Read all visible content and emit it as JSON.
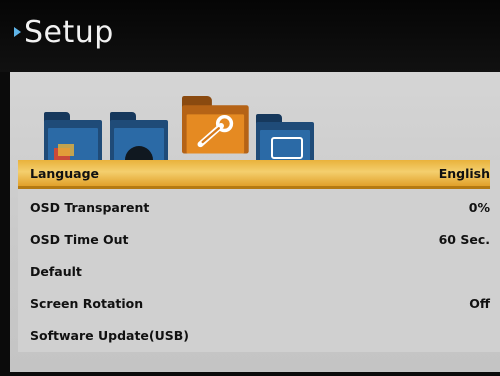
{
  "header": {
    "title": "Setup"
  },
  "tabs": [
    {
      "icon": "picture-folder-icon",
      "selected": false
    },
    {
      "icon": "sound-folder-icon",
      "selected": false
    },
    {
      "icon": "setup-wrench-folder-icon",
      "selected": true
    },
    {
      "icon": "screen-folder-icon",
      "selected": false
    }
  ],
  "menu": {
    "items": [
      {
        "label": "Language",
        "value": "English",
        "selected": true
      },
      {
        "label": "OSD Transparent",
        "value": "0%"
      },
      {
        "label": "OSD Time Out",
        "value": "60 Sec."
      },
      {
        "label": "Default",
        "value": ""
      },
      {
        "label": "Screen Rotation",
        "value": "Off"
      },
      {
        "label": "Software Update(USB)",
        "value": ""
      }
    ]
  },
  "colors": {
    "accent": "#f0c24f",
    "header_bg": "#0b0b0b",
    "panel_bg": "#cfcfcf",
    "folder": "#2b6aa6"
  }
}
